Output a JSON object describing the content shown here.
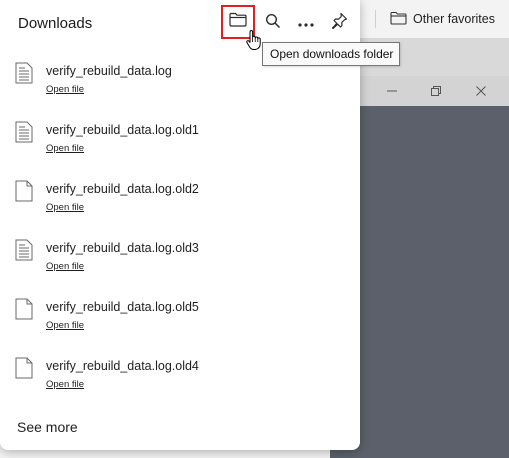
{
  "panel": {
    "title": "Downloads",
    "see_more_label": "See more",
    "open_file_label": "Open file"
  },
  "header_icons": {
    "open_folder": "folder-icon",
    "search": "search-icon",
    "more": "more-options-icon",
    "pin": "pin-icon"
  },
  "tooltip": {
    "text": "Open downloads folder"
  },
  "favorites_bar": {
    "other_favorites_label": "Other favorites"
  },
  "downloads": [
    {
      "name": "verify_rebuild_data.log",
      "link": "Open file",
      "icon": "text-file-icon"
    },
    {
      "name": "verify_rebuild_data.log.old1",
      "link": "Open file",
      "icon": "text-file-icon"
    },
    {
      "name": "verify_rebuild_data.log.old2",
      "link": "Open file",
      "icon": "blank-file-icon"
    },
    {
      "name": "verify_rebuild_data.log.old3",
      "link": "Open file",
      "icon": "text-file-icon"
    },
    {
      "name": "verify_rebuild_data.log.old5",
      "link": "Open file",
      "icon": "blank-file-icon"
    },
    {
      "name": "verify_rebuild_data.log.old4",
      "link": "Open file",
      "icon": "blank-file-icon"
    }
  ],
  "colors": {
    "highlight_border": "#e02020",
    "background_window": "#5b606a"
  }
}
